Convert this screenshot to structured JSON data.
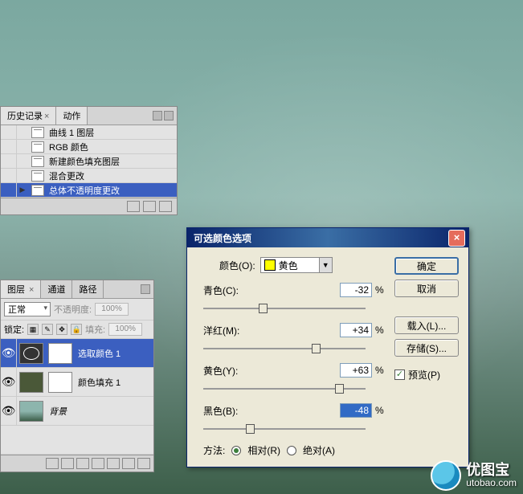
{
  "history": {
    "tab_history": "历史记录",
    "tab_actions": "动作",
    "items": [
      "曲线 1 图层",
      "RGB 颜色",
      "新建颜色填充图层",
      "混合更改",
      "总体不透明度更改"
    ]
  },
  "layers": {
    "tab_layers": "图层",
    "tab_channels": "通道",
    "tab_paths": "路径",
    "blend_mode": "正常",
    "opacity_label": "不透明度:",
    "opacity_value": "100%",
    "lock_label": "锁定:",
    "fill_label": "填充:",
    "fill_value": "100%",
    "items": [
      {
        "name": "选取颜色 1"
      },
      {
        "name": "颜色填充 1"
      },
      {
        "name": "背景"
      }
    ]
  },
  "dialog": {
    "title": "可选颜色选项",
    "color_label": "颜色(O):",
    "color_value": "黄色",
    "cyan": {
      "label": "青色(C):",
      "value": "-32",
      "percent": "%"
    },
    "magenta": {
      "label": "洋红(M):",
      "value": "+34",
      "percent": "%"
    },
    "yellow": {
      "label": "黄色(Y):",
      "value": "+63",
      "percent": "%"
    },
    "black": {
      "label": "黑色(B):",
      "value": "-48",
      "percent": "%"
    },
    "method_label": "方法:",
    "method_relative": "相对(R)",
    "method_absolute": "绝对(A)",
    "ok": "确定",
    "cancel": "取消",
    "load": "载入(L)...",
    "save": "存储(S)...",
    "preview": "预览(P)",
    "checkmark": "✓"
  },
  "watermark": {
    "brand": "优图宝",
    "url": "utobao.com"
  }
}
